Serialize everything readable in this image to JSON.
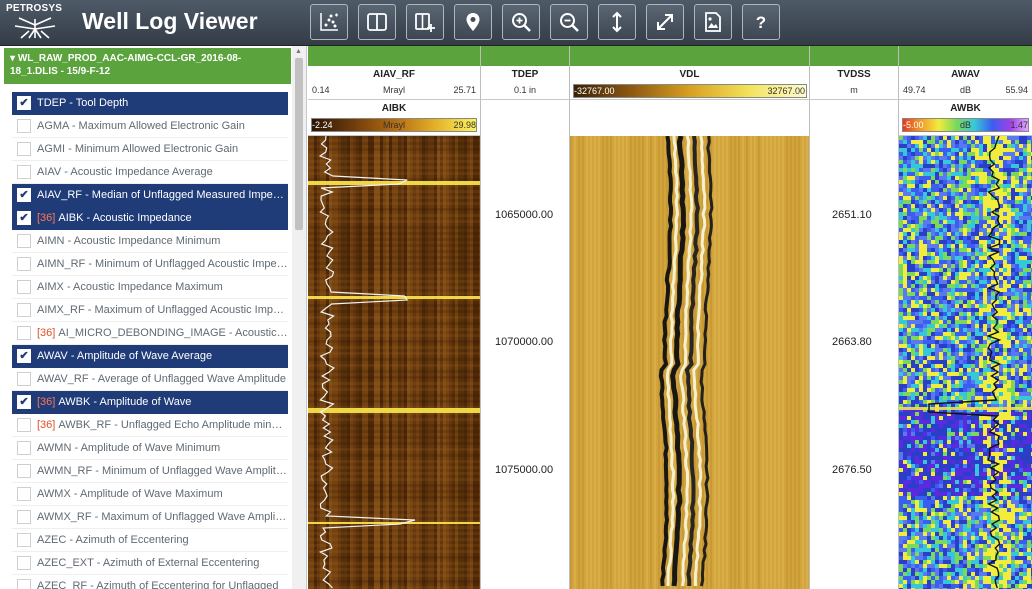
{
  "app": {
    "brand": "PETROSYS",
    "title": "Well Log Viewer"
  },
  "toolbar": [
    {
      "name": "crossplot-button",
      "icon": "crossplot-icon"
    },
    {
      "name": "split-view-button",
      "icon": "columns-icon"
    },
    {
      "name": "add-track-button",
      "icon": "add-track-icon"
    },
    {
      "name": "location-button",
      "icon": "map-marker-icon"
    },
    {
      "name": "zoom-in-button",
      "icon": "zoom-in-icon"
    },
    {
      "name": "zoom-out-button",
      "icon": "zoom-out-icon"
    },
    {
      "name": "vertical-fit-button",
      "icon": "vertical-arrows-icon"
    },
    {
      "name": "fullscreen-button",
      "icon": "expand-icon"
    },
    {
      "name": "export-image-button",
      "icon": "image-file-icon"
    },
    {
      "name": "help-button",
      "icon": "question-icon"
    }
  ],
  "sidebar": {
    "file_name": "WL_RAW_PROD_AAC-AIMG-CCL-GR_2016-08-18_1.DLIS - 15/9-F-12",
    "curves": [
      {
        "label": "TDEP - Tool Depth",
        "badge": "",
        "checked": true
      },
      {
        "label": "AGMA - Maximum Allowed Electronic Gain",
        "badge": "",
        "checked": false
      },
      {
        "label": "AGMI - Minimum Allowed Electronic Gain",
        "badge": "",
        "checked": false
      },
      {
        "label": "AIAV - Acoustic Impedance Average",
        "badge": "",
        "checked": false
      },
      {
        "label": "AIAV_RF - Median of Unflagged Measured Impeda...",
        "badge": "",
        "checked": true
      },
      {
        "label": "AIBK - Acoustic Impedance",
        "badge": "[36]",
        "checked": true
      },
      {
        "label": "AIMN - Acoustic Impedance Minimum",
        "badge": "",
        "checked": false
      },
      {
        "label": "AIMN_RF - Minimum of Unflagged Acoustic Imped...",
        "badge": "",
        "checked": false
      },
      {
        "label": "AIMX - Acoustic Impedance Maximum",
        "badge": "",
        "checked": false
      },
      {
        "label": "AIMX_RF - Maximum of Unflagged Acoustic Imped...",
        "badge": "",
        "checked": false
      },
      {
        "label": "AI_MICRO_DEBONDING_IMAGE - Acoustic I...",
        "badge": "[36]",
        "checked": false
      },
      {
        "label": "AWAV - Amplitude of Wave Average",
        "badge": "",
        "checked": true
      },
      {
        "label": "AWAV_RF - Average of Unflagged Wave Amplitude",
        "badge": "",
        "checked": false
      },
      {
        "label": "AWBK - Amplitude of Wave",
        "badge": "[36]",
        "checked": true
      },
      {
        "label": "AWBK_RF - Unflagged Echo Amplitude minus...",
        "badge": "[36]",
        "checked": false
      },
      {
        "label": "AWMN - Amplitude of Wave Minimum",
        "badge": "",
        "checked": false
      },
      {
        "label": "AWMN_RF - Minimum of Unflagged Wave Amplitude",
        "badge": "",
        "checked": false
      },
      {
        "label": "AWMX - Amplitude of Wave Maximum",
        "badge": "",
        "checked": false
      },
      {
        "label": "AWMX_RF - Maximum of Unflagged Wave Amplitude",
        "badge": "",
        "checked": false
      },
      {
        "label": "AZEC - Azimuth of Eccentering",
        "badge": "",
        "checked": false
      },
      {
        "label": "AZEC_EXT - Azimuth of External Eccentering",
        "badge": "",
        "checked": false
      },
      {
        "label": "AZEC_RF - Azimuth of Eccentering for Unflagged",
        "badge": "",
        "checked": false
      }
    ]
  },
  "tracks": {
    "aiav": {
      "name": "AIAV_RF",
      "min": "0.14",
      "unit": "Mrayl",
      "max": "25.71"
    },
    "aibk": {
      "name": "AIBK",
      "min": "-2.24",
      "unit": "Mrayl",
      "max": "29.98"
    },
    "tdep": {
      "name": "TDEP",
      "unit": "0.1 in",
      "depths": [
        "1065000.00",
        "1070000.00",
        "1075000.00"
      ]
    },
    "vdl": {
      "name": "VDL",
      "min": "-32767.00",
      "max": "32767.00"
    },
    "tvdss": {
      "name": "TVDSS",
      "unit": "m",
      "depths": [
        "2651.10",
        "2663.80",
        "2676.50"
      ]
    },
    "awav": {
      "name": "AWAV",
      "min": "49.74",
      "unit": "dB",
      "max": "55.94"
    },
    "awbk": {
      "name": "AWBK",
      "min": "-5.00",
      "unit": "dB",
      "max": "1.47"
    }
  },
  "colors": {
    "accent_green": "#5aa33d",
    "selected_row": "#1f3b78",
    "badge": "#e0502a"
  }
}
